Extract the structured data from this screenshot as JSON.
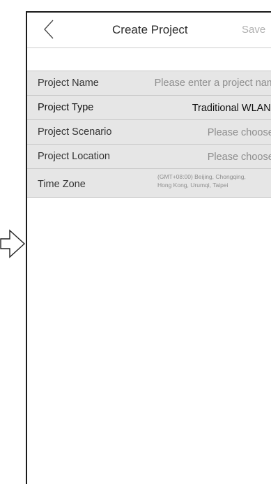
{
  "header": {
    "title": "Create Project",
    "save_label": "Save"
  },
  "fields": [
    {
      "label": "Project Name",
      "value": "Please enter a project name"
    },
    {
      "label": "Project Type",
      "value": "Traditional WLAN",
      "chevron": ">"
    },
    {
      "label": "Project Scenario",
      "value": "Please choose",
      "chevron": ">"
    },
    {
      "label": "Project Location",
      "value": "Please choose",
      "chevron": ">"
    },
    {
      "label": "Time Zone",
      "value_line1": "(GMT+08:00) Beijing, Chongqing,",
      "value_line2": "Hong Kong, Urumqi, Taipei"
    }
  ],
  "icons": {
    "next_arrow": "right-arrow-outline-icon",
    "back": "chevron-left-icon"
  }
}
